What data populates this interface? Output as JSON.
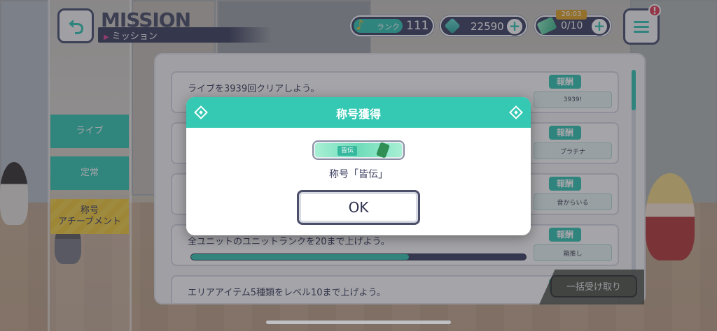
{
  "header": {
    "title_en": "MISSION",
    "title_jp": "ミッション",
    "rank_label": "ランク",
    "rank_value": "111",
    "gems": "22590",
    "ticket_timer": "26:03",
    "tickets": "0/10",
    "notification": "!"
  },
  "tabs": [
    {
      "label": "ライブ"
    },
    {
      "label": "定常"
    },
    {
      "label": "称号\nアチーブメント"
    }
  ],
  "missions": [
    {
      "text": "ライブを3939回クリアしよう。",
      "reward_label": "報酬",
      "reward_item": "3939!"
    },
    {
      "text": "",
      "reward_label": "報酬",
      "reward_item": "プラチナ"
    },
    {
      "text": "",
      "reward_label": "報酬",
      "reward_item": "音からいる"
    },
    {
      "text": "全ユニットのユニットランクを20まで上げよう。",
      "reward_label": "報酬",
      "reward_item": "箱推し",
      "progress": 0.65
    },
    {
      "text": "エリアアイテム5種類をレベル10まで上げよう。",
      "reward_label": "報"
    }
  ],
  "collect_all": "一括受け取り",
  "modal": {
    "title": "称号獲得",
    "badge_label": "皆伝",
    "title_name": "称号「皆伝」",
    "ok": "OK"
  },
  "colors": {
    "accent": "#35c8b2",
    "navy": "#3f4462",
    "yellow": "#f4d24a"
  },
  "icons": [
    "back-arrow-icon",
    "music-note-icon",
    "gem-icon",
    "ticket-icon",
    "plus-icon",
    "menu-icon",
    "diamond-icon"
  ]
}
